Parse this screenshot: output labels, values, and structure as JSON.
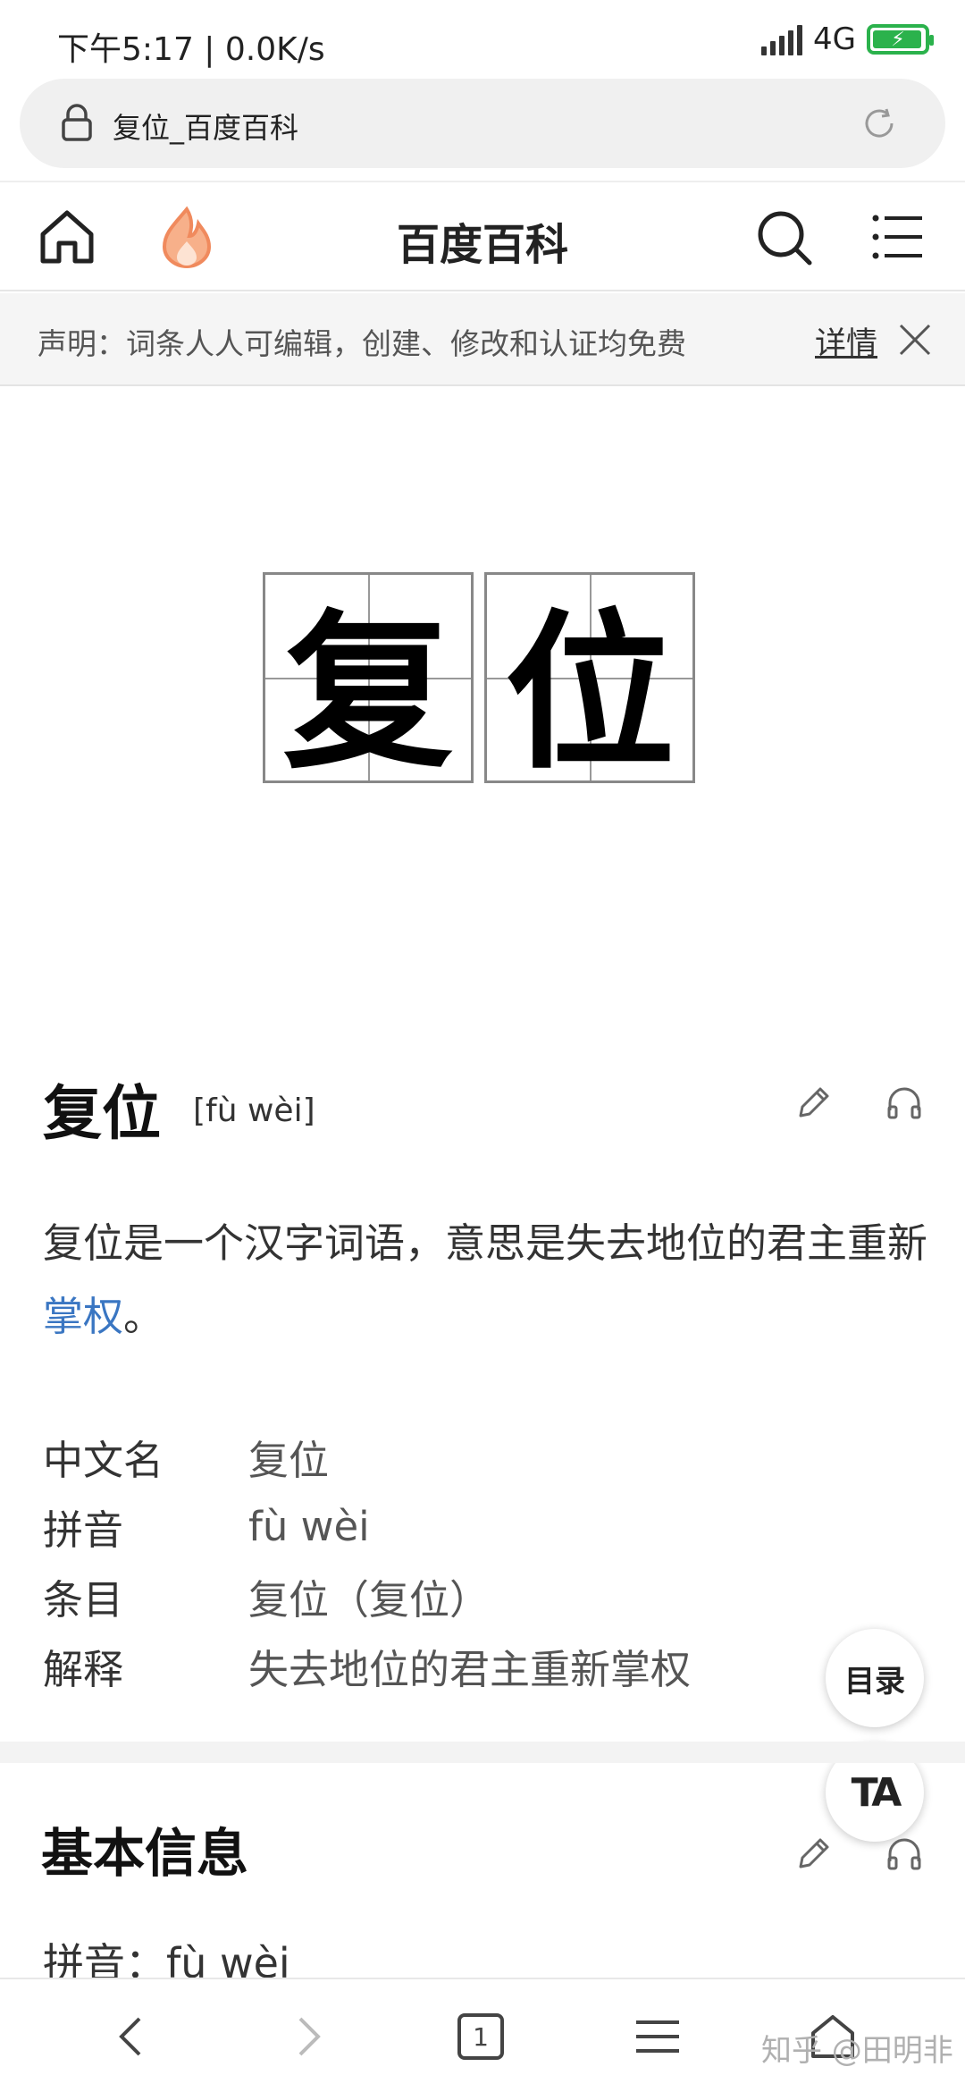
{
  "status_bar": {
    "time": "下午5:17 | 0.0K/s",
    "network": "4G"
  },
  "url_bar": {
    "title": "复位_百度百科"
  },
  "header": {
    "title": "百度百科"
  },
  "notice": {
    "text": "声明：词条人人可编辑，创建、修改和认证均免费",
    "detail_link": "详情"
  },
  "lead_image": {
    "chars": [
      "复",
      "位"
    ]
  },
  "entry": {
    "title": "复位",
    "pinyin": "[fù wèi]",
    "summary_prefix": "复位是一个汉字词语，意思是失去地位的君主重新",
    "summary_link": "掌权",
    "summary_suffix": "。"
  },
  "basic_info": [
    {
      "key": "中文名",
      "value": "复位"
    },
    {
      "key": "拼音",
      "value": "fù wèi"
    },
    {
      "key": "条目",
      "value": "复位（复位）"
    },
    {
      "key": "解释",
      "value": "失去地位的君主重新掌权"
    }
  ],
  "floating": {
    "toc": "目录",
    "ta": "TA"
  },
  "section": {
    "title": "基本信息",
    "line": "拼音：fù wèi"
  },
  "toolbar": {
    "tab_count": "1"
  },
  "watermark": "知乎 @田明非",
  "colors": {
    "link": "#3a76c2",
    "battery": "#2bb24c",
    "hot": "#f08a5d"
  }
}
